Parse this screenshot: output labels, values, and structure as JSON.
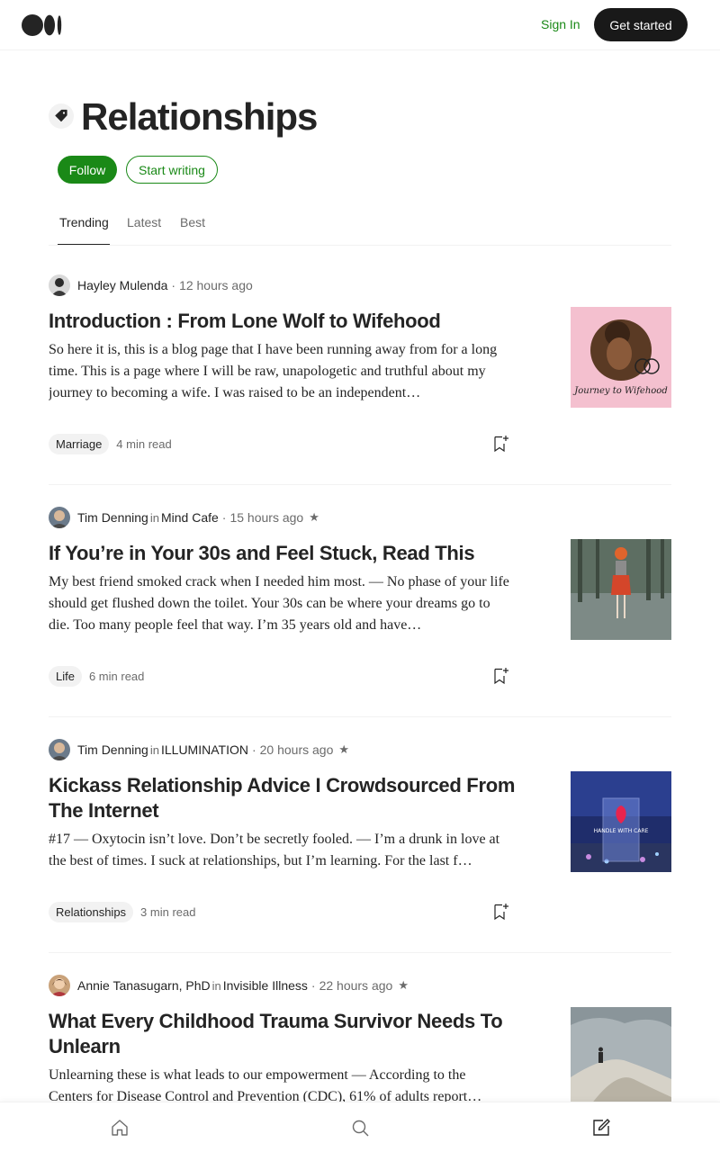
{
  "header": {
    "sign_in": "Sign In",
    "get_started": "Get started"
  },
  "tag": {
    "title": "Relationships",
    "follow": "Follow",
    "start_writing": "Start writing"
  },
  "tabs": [
    "Trending",
    "Latest",
    "Best"
  ],
  "articles": [
    {
      "author": "Hayley Mulenda",
      "in": "",
      "publication": "",
      "time": "12 hours ago",
      "member": false,
      "title": "Introduction : From Lone Wolf to Wifehood",
      "excerpt": "So here it is, this is a blog page that I have been running away from for a long time. This is a page where I will be raw, unapologetic and truthful about my journey to becoming a wife. I was raised to be an independent…",
      "tag": "Marriage",
      "read_time": "4 min read",
      "thumb_text": "Journey to Wifehood"
    },
    {
      "author": "Tim Denning",
      "in": "in",
      "publication": "Mind Cafe",
      "time": "15 hours ago",
      "member": true,
      "title": "If You’re in Your 30s and Feel Stuck, Read This",
      "excerpt": "My best friend smoked crack when I needed him most. — No phase of your life should get flushed down the toilet. Your 30s can be where your dreams go to die. Too many people feel that way. I’m 35 years old and have…",
      "tag": "Life",
      "read_time": "6 min read",
      "thumb_text": ""
    },
    {
      "author": "Tim Denning",
      "in": "in",
      "publication": "ILLUMINATION",
      "time": "20 hours ago",
      "member": true,
      "title": "Kickass Relationship Advice I Crowdsourced From The Internet",
      "excerpt": "#17 — Oxytocin isn’t love. Don’t be secretly fooled. — I’m a drunk in love at the best of times. I suck at relationships, but I’m learning. For the last f…",
      "tag": "Relationships",
      "read_time": "3 min read",
      "thumb_text": "HANDLE WITH CARE"
    },
    {
      "author": "Annie Tanasugarn, PhD",
      "in": "in",
      "publication": "Invisible Illness",
      "time": "22 hours ago",
      "member": true,
      "title": "What Every Childhood Trauma Survivor Needs To Unlearn",
      "excerpt": "Unlearning these is what leads to our empowerment — According to the Centers for Disease Control and Prevention (CDC), 61% of adults report…",
      "tag": "",
      "read_time": "",
      "thumb_text": ""
    }
  ],
  "separators": {
    "dot": "·",
    "star": "★"
  },
  "colors": {
    "accent": "#1a8917",
    "text": "#242424",
    "muted": "#6b6b6b",
    "chip_bg": "#f2f2f2"
  },
  "icons": {
    "logo": "medium-logo",
    "tag": "tag-icon",
    "bookmark": "bookmark-add-icon",
    "home": "home-icon",
    "search": "search-icon",
    "write": "write-icon"
  }
}
